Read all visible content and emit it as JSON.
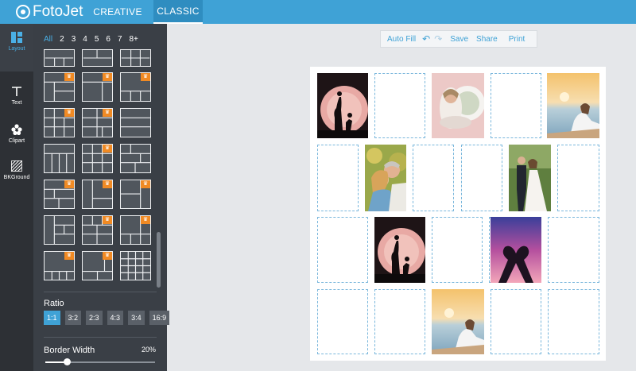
{
  "app": {
    "logo_text": "FotoJet",
    "nav": [
      "CREATIVE",
      "CLASSIC"
    ],
    "active_nav": "CLASSIC",
    "accent_color": "#3fa2d6"
  },
  "rail": [
    {
      "label": "Layout",
      "icon": "layout-icon",
      "active": true
    },
    {
      "label": "Text",
      "icon": "text-icon",
      "active": false
    },
    {
      "label": "Clipart",
      "icon": "clipart-icon",
      "active": false
    },
    {
      "label": "BKGround",
      "icon": "background-icon",
      "active": false
    }
  ],
  "layout_panel": {
    "filters": [
      "All",
      "2",
      "3",
      "4",
      "5",
      "6",
      "7",
      "8+"
    ],
    "active_filter": "All",
    "premium_badge_icon": "crown-icon",
    "ratio_label": "Ratio",
    "ratios": [
      "1:1",
      "3:2",
      "2:3",
      "4:3",
      "3:4",
      "16:9"
    ],
    "active_ratio": "1:1",
    "border_width_label": "Border Width",
    "border_width_value": "20%",
    "border_width_level": 0.2
  },
  "toolbar": {
    "auto_fill": "Auto Fill",
    "undo_icon": "undo-icon",
    "redo_icon": "redo-icon",
    "save": "Save",
    "share": "Share",
    "print": "Print"
  },
  "canvas": {
    "rows": [
      [
        "photo-silhouette-moon",
        "empty",
        "photo-couple-hug",
        "empty",
        "photo-seaside-woman"
      ],
      [
        "empty",
        "photo-smiling-couple",
        "empty",
        "empty",
        "photo-wedding-couple",
        "empty"
      ],
      [
        "empty",
        "photo-silhouette-moon",
        "empty",
        "photo-heart-hands",
        "empty"
      ],
      [
        "empty",
        "empty",
        "photo-seaside-woman",
        "empty",
        "empty"
      ]
    ]
  }
}
